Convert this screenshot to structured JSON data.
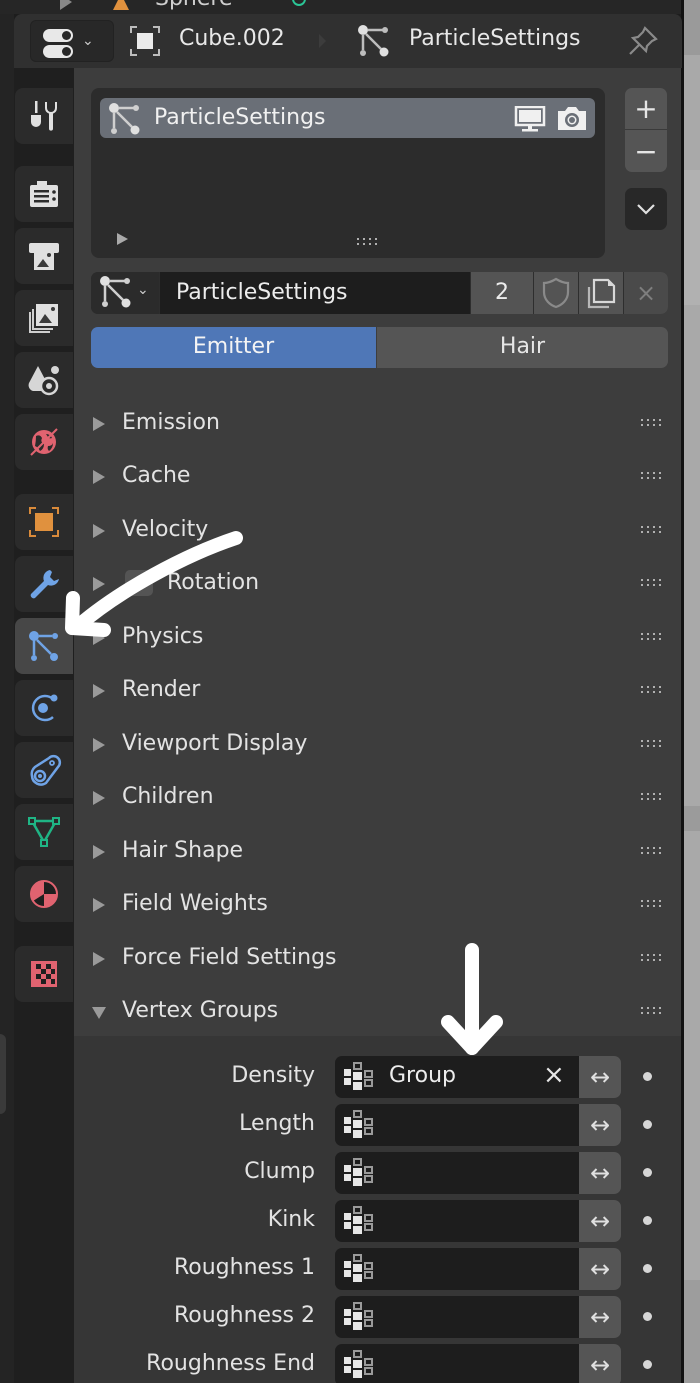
{
  "outliner": {
    "partial_item": "Sphere"
  },
  "header": {
    "editor_type": "properties-editor",
    "breadcrumb": [
      {
        "icon": "object-icon",
        "label": "Cube.002"
      },
      {
        "icon": "particles-icon",
        "label": "ParticleSettings"
      }
    ],
    "pin_icon": "pin-icon"
  },
  "tabs": [
    {
      "name": "tool",
      "icon": "tool-icon",
      "active": false
    },
    {
      "name": "render",
      "icon": "render-icon",
      "active": false
    },
    {
      "name": "output",
      "icon": "output-icon",
      "active": false
    },
    {
      "name": "view-layer",
      "icon": "view-layer-icon",
      "active": false
    },
    {
      "name": "scene",
      "icon": "scene-icon",
      "active": false
    },
    {
      "name": "world",
      "icon": "world-icon",
      "active": false
    },
    {
      "name": "object",
      "icon": "object-icon",
      "active": false
    },
    {
      "name": "modifiers",
      "icon": "wrench-icon",
      "active": false
    },
    {
      "name": "particles",
      "icon": "particles-icon",
      "active": true
    },
    {
      "name": "physics",
      "icon": "physics-icon",
      "active": false
    },
    {
      "name": "constraints",
      "icon": "constraints-icon",
      "active": false
    },
    {
      "name": "data",
      "icon": "mesh-data-icon",
      "active": false
    },
    {
      "name": "material",
      "icon": "material-icon",
      "active": false
    },
    {
      "name": "texture",
      "icon": "texture-icon",
      "active": false
    }
  ],
  "particle_systems": {
    "items": [
      {
        "label": "ParticleSettings",
        "selected": true
      }
    ],
    "add_label": "+",
    "remove_label": "−"
  },
  "datablock": {
    "name": "ParticleSettings",
    "users": "2",
    "unlink_label": "×"
  },
  "type_toggle": {
    "options": [
      "Emitter",
      "Hair"
    ],
    "selected": "Emitter"
  },
  "panels": [
    {
      "label": "Emission",
      "expanded": false
    },
    {
      "label": "Cache",
      "expanded": false
    },
    {
      "label": "Velocity",
      "expanded": false
    },
    {
      "label": "Rotation",
      "expanded": false,
      "checkbox": false
    },
    {
      "label": "Physics",
      "expanded": false
    },
    {
      "label": "Render",
      "expanded": false
    },
    {
      "label": "Viewport Display",
      "expanded": false
    },
    {
      "label": "Children",
      "expanded": false
    },
    {
      "label": "Hair Shape",
      "expanded": false
    },
    {
      "label": "Field Weights",
      "expanded": false
    },
    {
      "label": "Force Field Settings",
      "expanded": false
    },
    {
      "label": "Vertex Groups",
      "expanded": true
    }
  ],
  "vertex_groups": [
    {
      "label": "Density",
      "value": "Group",
      "clear": "×",
      "invert": "↔"
    },
    {
      "label": "Length",
      "value": "",
      "invert": "↔"
    },
    {
      "label": "Clump",
      "value": "",
      "invert": "↔"
    },
    {
      "label": "Kink",
      "value": "",
      "invert": "↔"
    },
    {
      "label": "Roughness 1",
      "value": "",
      "invert": "↔"
    },
    {
      "label": "Roughness 2",
      "value": "",
      "invert": "↔"
    },
    {
      "label": "Roughness End",
      "value": "",
      "invert": "↔"
    }
  ],
  "colors": {
    "accent_blue": "#4f77b7",
    "panel_bg": "#3d3d3d",
    "field_bg": "#1d1d1d",
    "world_red": "#e06370",
    "object_orange": "#e0913e",
    "particles_blue": "#6fa3e6",
    "data_green": "#1fb585"
  }
}
